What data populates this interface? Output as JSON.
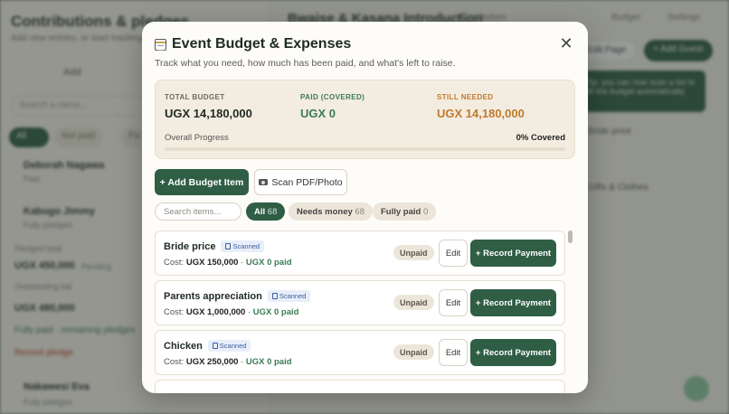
{
  "modal": {
    "title": "Event Budget & Expenses",
    "title_icon": "ledger-icon",
    "close_icon": "close-icon",
    "close_glyph": "✕",
    "subtitle": "Track what you need, how much has been paid, and what's left to raise.",
    "summary": {
      "total_label": "TOTAL BUDGET",
      "total_value": "UGX 14,180,000",
      "paid_label": "PAID (COVERED)",
      "paid_value": "UGX 0",
      "needed_label": "STILL NEEDED",
      "needed_value": "UGX 14,180,000",
      "progress_label": "Overall Progress",
      "progress_value": "0% Covered",
      "progress_fraction": 0
    },
    "add_button": "+ Add Budget Item",
    "scan_button": "Scan PDF/Photo",
    "scan_icon": "camera-icon",
    "search_placeholder": "Search items...",
    "filters": [
      {
        "label": "All",
        "count": "68",
        "active": true
      },
      {
        "label": "Needs money",
        "count": "68",
        "active": false
      },
      {
        "label": "Fully paid",
        "count": "0",
        "active": false
      }
    ],
    "items": [
      {
        "name": "Bride price",
        "badge": "Scanned",
        "cost_prefix": "Cost:",
        "cost": "UGX 150,000",
        "separator": "·",
        "paid": "UGX 0 paid",
        "status": "Unpaid",
        "edit": "Edit",
        "pay": "+ Record Payment"
      },
      {
        "name": "Parents appreciation",
        "badge": "Scanned",
        "cost_prefix": "Cost:",
        "cost": "UGX 1,000,000",
        "separator": "·",
        "paid": "UGX 0 paid",
        "status": "Unpaid",
        "edit": "Edit",
        "pay": "+ Record Payment"
      },
      {
        "name": "Chicken",
        "badge": "Scanned",
        "cost_prefix": "Cost:",
        "cost": "UGX 250,000",
        "separator": "·",
        "paid": "UGX 0 paid",
        "status": "Unpaid",
        "edit": "Edit",
        "pay": "+ Record Payment"
      }
    ]
  },
  "background": {
    "left_title": "Contributions & pledges",
    "left_subtitle": "Add new entries, or start tracking as you go",
    "tab_word": "Add",
    "search": "Search a name...",
    "pill_all": "All",
    "pill_fully": "Not paid",
    "pill_more": "Pa",
    "rows": [
      {
        "name": "Deborah Nagawa",
        "sub": "Paid"
      },
      {
        "name": "Kabugo Jimmy",
        "sub": "Fully pledged"
      }
    ],
    "amount_label": "Pledged total",
    "amount": "UGX 450,000",
    "amount_note": "Pending",
    "balance_label": "Outstanding bal",
    "balance": "UGX 480,000",
    "fully_paid_note": "Fully paid · remaining pledges",
    "record_link": "Record pledge",
    "bottom_name": "Nakawesi Eva",
    "bottom_sub": "Fully pledged",
    "right_title": "Bwaise & Kasana Introduction",
    "nav": [
      "Contributors",
      "Budget",
      "Settings"
    ],
    "btn_light": "Edit Page",
    "btn_dark": "+ Add Guest",
    "banner": "Tip: you can now scan a list to fill the budget automatically.",
    "lines": [
      "Bride price",
      "Gifts & Clothes"
    ]
  },
  "colors": {
    "primary": "#2f5e45",
    "paid_green": "#3d7a55",
    "needed_orange": "#c07a2c",
    "summary_bg": "#f3ece0",
    "scanned_blue": "#3a5fa0"
  }
}
